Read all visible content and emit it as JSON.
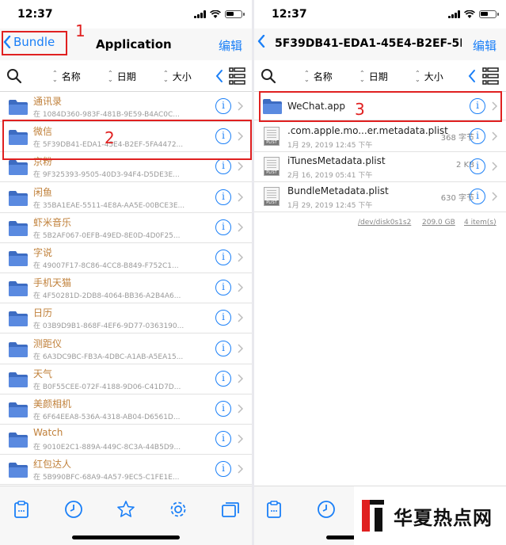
{
  "status": {
    "time": "12:37"
  },
  "left": {
    "back_label": "Bundle",
    "title": "Application",
    "edit_label": "编辑",
    "sort": {
      "name": "名称",
      "date": "日期",
      "size": "大小"
    },
    "items": [
      {
        "name": "通讯录",
        "sub": "在 1084D360-983F-481B-9E59-B4AC0C..."
      },
      {
        "name": "微信",
        "sub": "在 5F39DB41-EDA1-45E4-B2EF-5FA4472..."
      },
      {
        "name": "京粉",
        "sub": "在 9F325393-9505-40D3-94F4-D5DE3E..."
      },
      {
        "name": "闲鱼",
        "sub": "在 35BA1EAE-5511-4E8A-AA5E-00BCE3E..."
      },
      {
        "name": "虾米音乐",
        "sub": "在 5B2AF067-0EFB-49ED-8E0D-4D0F25..."
      },
      {
        "name": "字说",
        "sub": "在 49007F17-8C86-4CC8-B849-F752C1..."
      },
      {
        "name": "手机天猫",
        "sub": "在 4F50281D-2DB8-4064-BB36-A2B4A6..."
      },
      {
        "name": "日历",
        "sub": "在 03B9D9B1-868F-4EF6-9D77-0363190..."
      },
      {
        "name": "测距仪",
        "sub": "在 6A3DC9BC-FB3A-4DBC-A1AB-A5EA15..."
      },
      {
        "name": "天气",
        "sub": "在 B0F55CEE-072F-4188-9D06-C41D7D..."
      },
      {
        "name": "美颜相机",
        "sub": "在 6F64EEA8-536A-4318-AB04-D6561D..."
      },
      {
        "name": "Watch",
        "sub": "在 9010E2C1-889A-449C-8C3A-44B5D9..."
      },
      {
        "name": "红包达人",
        "sub": "在 5B990BFC-68A9-4A57-9EC5-C1FE1E..."
      }
    ]
  },
  "right": {
    "title": "5F39DB41-EDA1-45E4-B2EF-5F...",
    "edit_label": "编辑",
    "sort": {
      "name": "名称",
      "date": "日期",
      "size": "大小"
    },
    "folder_name": "WeChat.app",
    "files": [
      {
        "name": ".com.apple.mo...er.metadata.plist",
        "date": "1月 29, 2019 12:45 下午",
        "size": "368 字节"
      },
      {
        "name": "iTunesMetadata.plist",
        "date": "2月 16, 2019 05:41 下午",
        "size": "2 KB"
      },
      {
        "name": "BundleMetadata.plist",
        "date": "1月 29, 2019 12:45 下午",
        "size": "630 字节"
      }
    ],
    "footer": {
      "path": "/dev/disk0s1s2",
      "capacity": "209.0 GB",
      "count": "4 item(s)"
    }
  },
  "annotations": {
    "one": "1",
    "two": "2",
    "three": "3"
  },
  "watermark": {
    "text": "华夏热点网"
  },
  "colors": {
    "accent": "#1a7ff7",
    "annotation": "#e02020",
    "folder": "#4a7bd4"
  }
}
